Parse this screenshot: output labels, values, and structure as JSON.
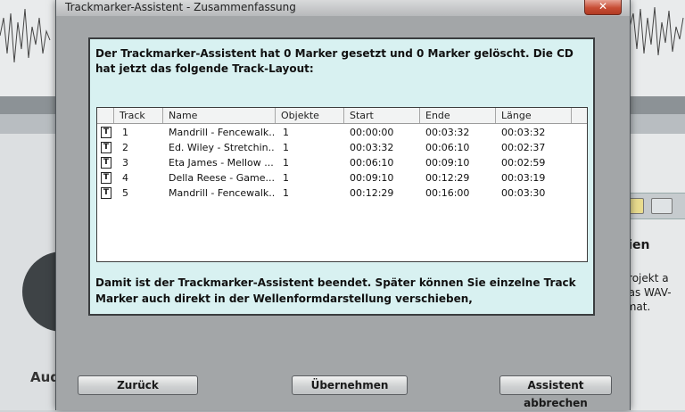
{
  "background": {
    "right_heading": "teien",
    "right_lines": [
      "Projekt a",
      "das WAV-",
      "rmat."
    ],
    "bottom_left_label": "Aud"
  },
  "dialog": {
    "title": "Trackmarker-Assistent - Zusammenfassung",
    "close_glyph": "✕",
    "header_text": "Der Trackmarker-Assistent hat 0 Marker gesetzt und 0 Marker gelöscht. Die CD hat jetzt das folgende Track-Layout:",
    "footer_text": "Damit ist der Trackmarker-Assistent beendet. Später können Sie einzelne Track Marker auch direkt in der Wellenformdarstellung verschieben,",
    "columns": [
      "Track",
      "Name",
      "Objekte",
      "Start",
      "Ende",
      "Länge"
    ],
    "row_icon": "T",
    "rows": [
      {
        "track": "1",
        "name": "Mandrill - Fencewalk...",
        "objekte": "1",
        "start": "00:00:00",
        "ende": "00:03:32",
        "laenge": "00:03:32"
      },
      {
        "track": "2",
        "name": "Ed. Wiley - Stretchin...",
        "objekte": "1",
        "start": "00:03:32",
        "ende": "00:06:10",
        "laenge": "00:02:37"
      },
      {
        "track": "3",
        "name": "Eta James - Mellow ...",
        "objekte": "1",
        "start": "00:06:10",
        "ende": "00:09:10",
        "laenge": "00:02:59"
      },
      {
        "track": "4",
        "name": "Della Reese - Game...",
        "objekte": "1",
        "start": "00:09:10",
        "ende": "00:12:29",
        "laenge": "00:03:19"
      },
      {
        "track": "5",
        "name": "Mandrill - Fencewalk...",
        "objekte": "1",
        "start": "00:12:29",
        "ende": "00:16:00",
        "laenge": "00:03:30"
      }
    ],
    "buttons": {
      "back": "Zurück",
      "apply": "Übernehmen",
      "cancel": "Assistent abbrechen"
    }
  }
}
